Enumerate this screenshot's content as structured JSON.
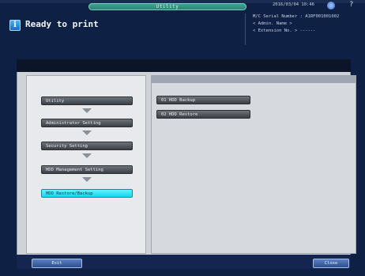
{
  "header": {
    "utility_tab": "Utility",
    "datetime": "2016/03/04 10:46",
    "status_text": "Ready to print",
    "machine": {
      "serial_line": "M/C Serial Number : A1RF001001002",
      "admin_line": "< Admin. Name >",
      "extension_line": "< Extension No. > ------"
    }
  },
  "breadcrumb": {
    "items": [
      {
        "label": "Utility"
      },
      {
        "label": "Administrator Setting"
      },
      {
        "label": "Security Setting"
      },
      {
        "label": "HDD Management Setting"
      },
      {
        "label": "HDD Restore/Backup"
      }
    ]
  },
  "functions": {
    "items": [
      {
        "label": "01 HDD Backup"
      },
      {
        "label": "02 HDD Restore"
      }
    ]
  },
  "footer": {
    "exit_label": "Exit",
    "close_label": "Close"
  },
  "colors": {
    "active_item": "#14d6ec",
    "utility_tab": "#3ea896",
    "header_bg": "#0e2144"
  }
}
